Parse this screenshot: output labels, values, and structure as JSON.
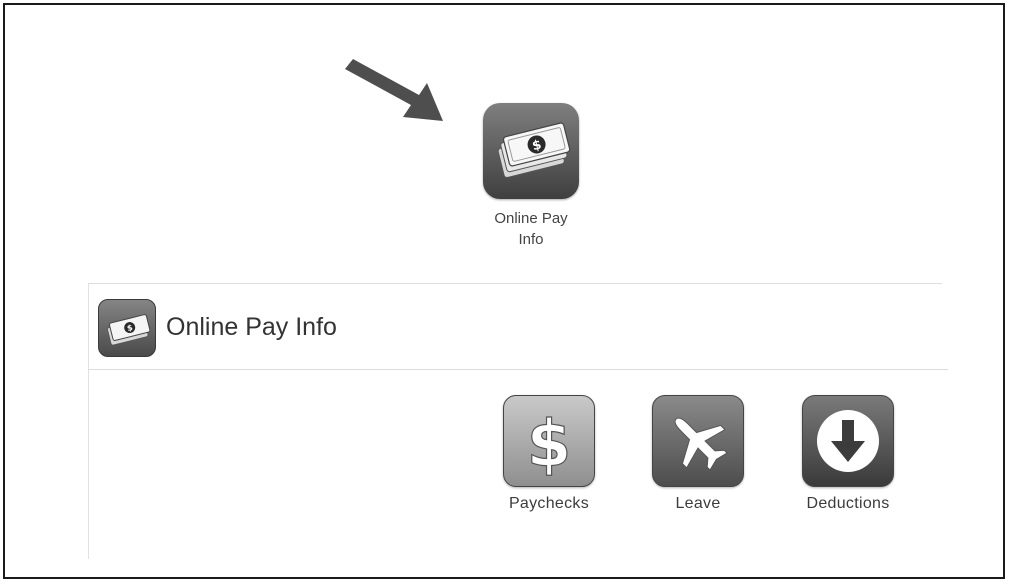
{
  "app_launcher": {
    "icon": "money-icon",
    "label_line1": "Online Pay",
    "label_line2": "Info"
  },
  "module": {
    "title": "Online Pay Info",
    "header_icon": "money-icon",
    "items": [
      {
        "label": "Paychecks",
        "icon": "dollar-icon"
      },
      {
        "label": "Leave",
        "icon": "airplane-icon"
      },
      {
        "label": "Deductions",
        "icon": "down-arrow-icon"
      }
    ]
  }
}
